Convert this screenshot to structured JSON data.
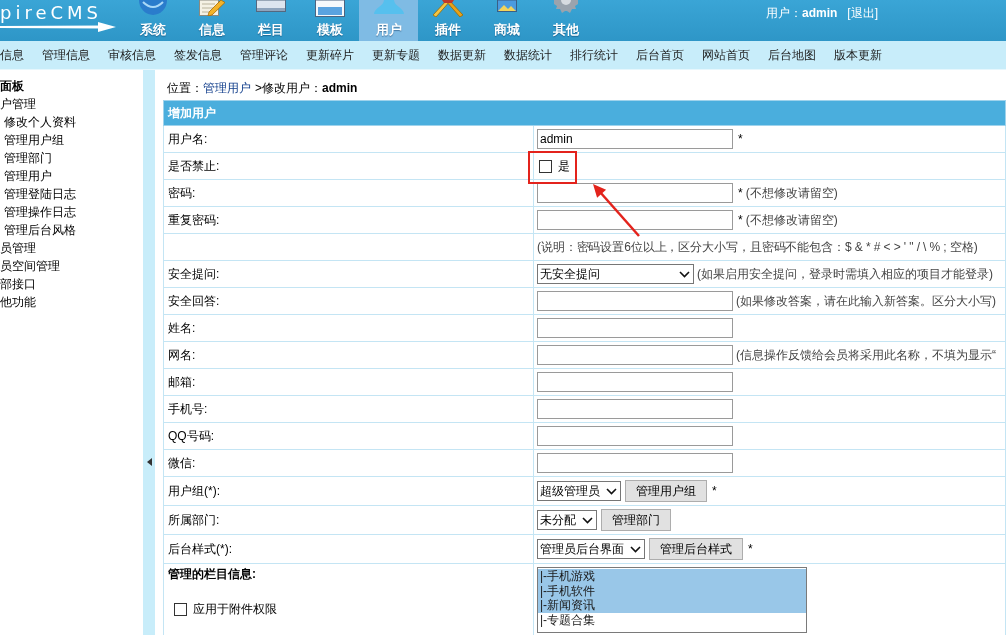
{
  "header": {
    "logo": "pireCMS",
    "nav": [
      {
        "label": "系统",
        "selected": false
      },
      {
        "label": "信息",
        "selected": false
      },
      {
        "label": "栏目",
        "selected": false
      },
      {
        "label": "模板",
        "selected": false
      },
      {
        "label": "用户",
        "selected": true
      },
      {
        "label": "插件",
        "selected": false
      },
      {
        "label": "商城",
        "selected": false
      },
      {
        "label": "其他",
        "selected": false
      }
    ],
    "user": "用户：**admin**",
    "logout": "[退出]"
  },
  "subnav": [
    "信息",
    "管理信息",
    "审核信息",
    "签发信息",
    "管理评论",
    "更新碎片",
    "更新专题",
    "数据更新",
    "数据统计",
    "排行统计",
    "后台首页",
    "网站首页",
    "后台地图",
    "版本更新"
  ],
  "sidebar": {
    "title": "面板",
    "items": [
      {
        "label": "户管理",
        "children": [
          {
            "label": "修改个人资料"
          },
          {
            "label": "管理用户组"
          },
          {
            "label": "管理部门"
          },
          {
            "label": "管理用户"
          },
          {
            "label": "管理登陆日志"
          },
          {
            "label": "管理操作日志"
          },
          {
            "label": "管理后台风格"
          }
        ]
      },
      {
        "label": "员管理"
      },
      {
        "label": "员空间管理"
      },
      {
        "label": "部接口"
      },
      {
        "label": "他功能"
      }
    ]
  },
  "breadcrumb": {
    "prefix": "位置：",
    "link": "管理用户",
    "rest": ">修改用户：**admin**"
  },
  "form": {
    "title": "增加用户",
    "rows": [
      {
        "kind": "input",
        "label": "用户名:",
        "value": "admin",
        "suffix": "*"
      },
      {
        "kind": "checkbox",
        "label": "是否禁止:",
        "option": "是",
        "checked": false
      },
      {
        "kind": "input",
        "label": "密码:",
        "suffix": "*",
        "hint": "(不想修改请留空)"
      },
      {
        "kind": "input",
        "label": "重复密码:",
        "suffix": "*",
        "hint": "(不想修改请留空)"
      },
      {
        "kind": "note",
        "text": "(说明：密码设置6位以上，区分大小写，且密码不能包含：$ & * # < > ' \" / \\ % ; 空格)"
      },
      {
        "kind": "select",
        "label": "安全提问:",
        "value": "无安全提问",
        "hint": "(如果启用安全提问，登录时需填入相应的项目才能登录)"
      },
      {
        "kind": "input",
        "label": "安全回答:",
        "hint": "(如果修改答案，请在此输入新答案。区分大小写)"
      },
      {
        "kind": "input",
        "label": "姓名:"
      },
      {
        "kind": "input",
        "label": "网名:",
        "hint": "(信息操作反馈给会员将采用此名称，不填为显示“"
      },
      {
        "kind": "input",
        "label": "邮箱:"
      },
      {
        "kind": "input",
        "label": "手机号:"
      },
      {
        "kind": "input",
        "label": "QQ号码:"
      },
      {
        "kind": "input",
        "label": "微信:"
      },
      {
        "kind": "select",
        "label": "用户组(*):",
        "value": "超级管理员",
        "button": "管理用户组",
        "suffix": "*"
      },
      {
        "kind": "select",
        "label": "所属部门:",
        "value": "未分配",
        "button": "管理部门"
      },
      {
        "kind": "select",
        "label": "后台样式(*):",
        "value": "管理员后台界面",
        "button": "管理后台样式",
        "suffix": "*"
      },
      {
        "kind": "multiselect",
        "label": "管理的栏目信息:",
        "option": "应用于附件权限",
        "checked": false,
        "options": [
          {
            "label": "|-手机游戏",
            "selected": true
          },
          {
            "label": "|-手机软件",
            "selected": true
          },
          {
            "label": "|-新闻资讯",
            "selected": true
          },
          {
            "label": "|-专题合集",
            "selected": false
          }
        ]
      }
    ]
  }
}
